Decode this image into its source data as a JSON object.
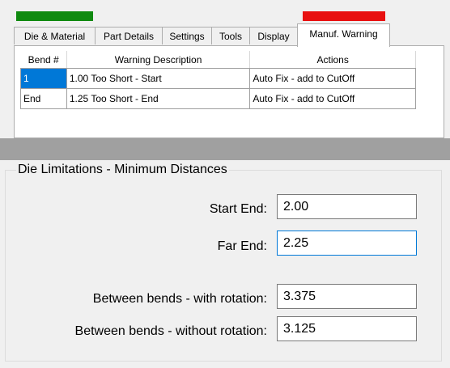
{
  "colors": {
    "status_green": "#108a10",
    "status_red": "#e81010",
    "selection": "#0078d7"
  },
  "tabs": [
    {
      "label": "Die & Material",
      "active": false
    },
    {
      "label": "Part Details",
      "active": false
    },
    {
      "label": "Settings",
      "active": false
    },
    {
      "label": "Tools",
      "active": false
    },
    {
      "label": "Display",
      "active": false
    },
    {
      "label": "Manuf. Warning",
      "active": true
    }
  ],
  "warnings_table": {
    "columns": [
      "Bend #",
      "Warning Description",
      "Actions"
    ],
    "rows": [
      {
        "bend": "1",
        "description": "1.00 Too Short - Start",
        "action": "Auto Fix - add to CutOff",
        "selected": true
      },
      {
        "bend": "End",
        "description": "1.25 Too Short - End",
        "action": "Auto Fix - add to CutOff",
        "selected": false
      }
    ]
  },
  "die_limits": {
    "title": "Die Limitations - Minimum Distances",
    "start_end_label": "Start End:",
    "start_end_value": "2.00",
    "far_end_label": "Far End:",
    "far_end_value": "2.25",
    "with_rotation_label": "Between bends - with rotation:",
    "with_rotation_value": "3.375",
    "without_rotation_label": "Between bends - without rotation:",
    "without_rotation_value": "3.125"
  }
}
